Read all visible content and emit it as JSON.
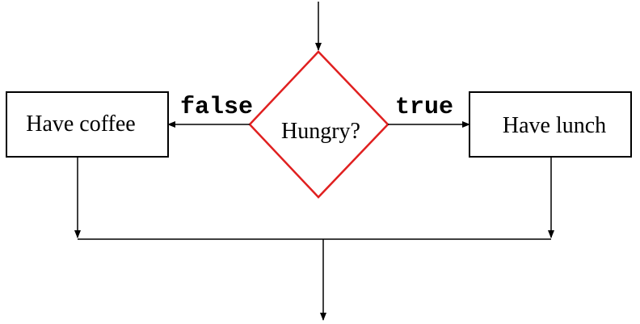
{
  "diagram": {
    "nodes": {
      "decision": {
        "label": "Hungry?",
        "shape": "diamond",
        "stroke_color": "#e02020"
      },
      "left": {
        "label": "Have coffee",
        "shape": "rectangle"
      },
      "right": {
        "label": "Have lunch",
        "shape": "rectangle"
      }
    },
    "edges": {
      "false_label": "false",
      "true_label": "true"
    },
    "colors": {
      "line": "#000000",
      "decision_border": "#e02020",
      "background": "#ffffff"
    }
  }
}
